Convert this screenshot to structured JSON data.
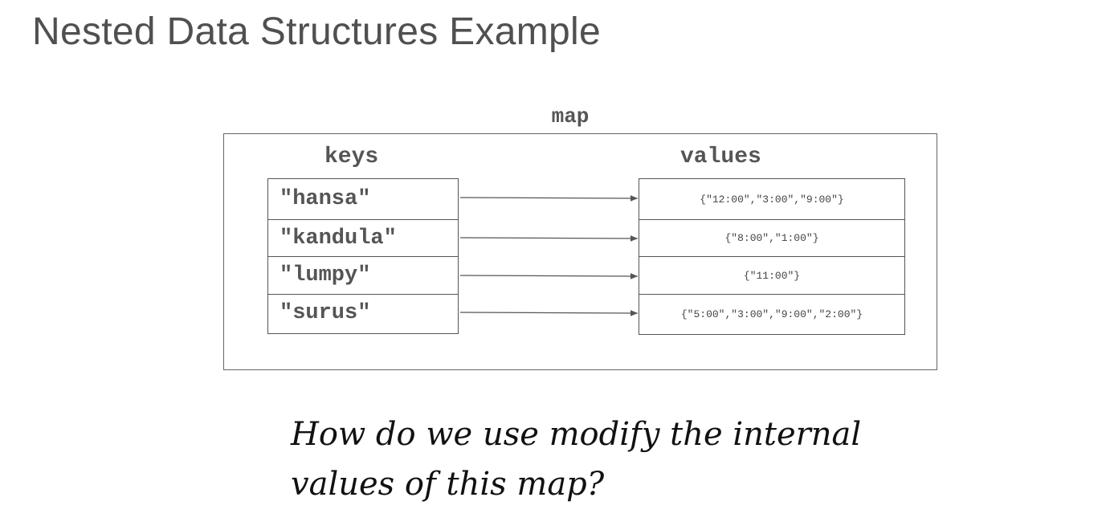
{
  "title": "Nested Data Structures Example",
  "diagram": {
    "map_label": "map",
    "keys_label": "keys",
    "values_label": "values",
    "entries": [
      {
        "key": "\"hansa\"",
        "value": "{\"12:00\",\"3:00\",\"9:00\"}"
      },
      {
        "key": "\"kandula\"",
        "value": "{\"8:00\",\"1:00\"}"
      },
      {
        "key": "\"lumpy\"",
        "value": "{\"11:00\"}"
      },
      {
        "key": "\"surus\"",
        "value": "{\"5:00\",\"3:00\",\"9:00\",\"2:00\"}"
      }
    ]
  },
  "question": {
    "line1": "How do we use modify the internal",
    "line2": "values of this map?"
  }
}
